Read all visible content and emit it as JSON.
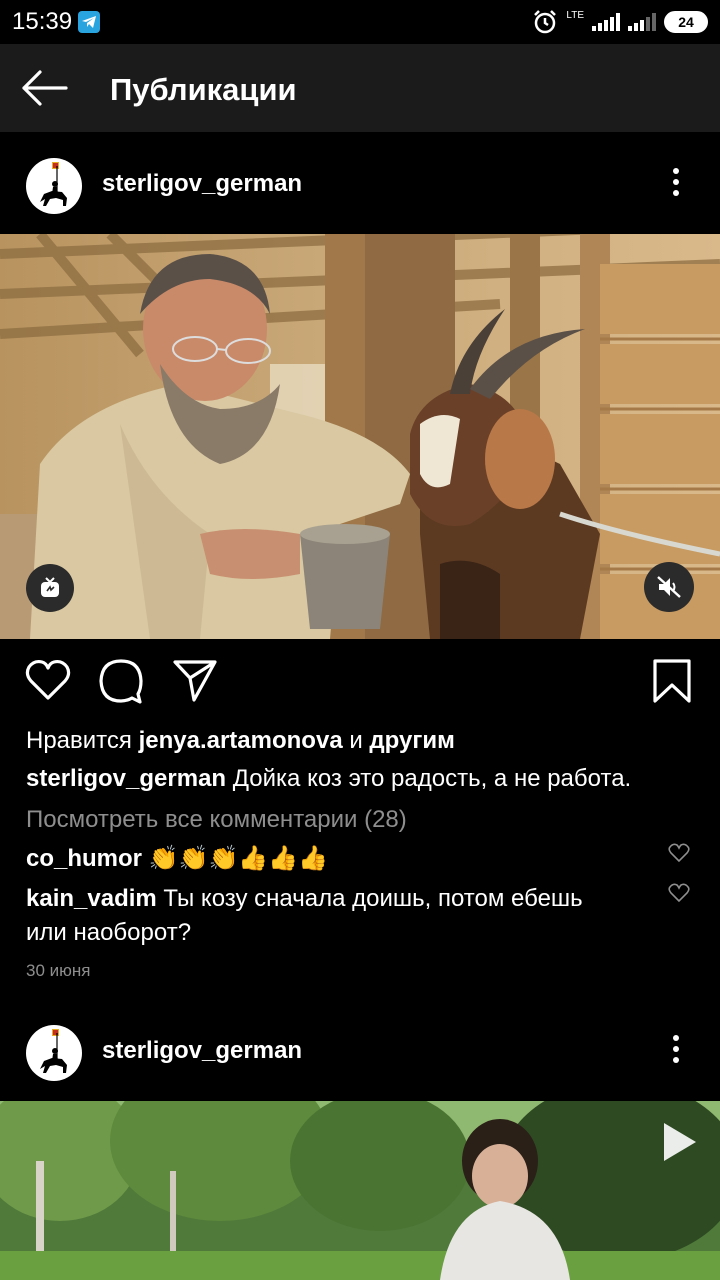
{
  "status_bar": {
    "time": "15:39",
    "network_label": "LTE",
    "battery": "24",
    "icons": [
      "telegram-icon",
      "alarm-icon",
      "signal-icon",
      "battery-icon"
    ]
  },
  "app_bar": {
    "title": "Публикации",
    "back_icon": "back-arrow-icon"
  },
  "posts": [
    {
      "username": "sterligov_german",
      "likes": {
        "prefix": "Нравится ",
        "user": "jenya.artamonova",
        "middle": " и ",
        "others": "другим"
      },
      "caption": {
        "user": "sterligov_german",
        "text": " Дойка коз это радость, а не работа."
      },
      "view_comments": "Посмотреть все комментарии (28)",
      "comments": [
        {
          "user": "co_humor",
          "text": " 👏👏👏👍👍👍"
        },
        {
          "user": "kain_vadim",
          "text": " Ты козу сначала доишь, потом ебешь",
          "text2": "или наоборот?"
        }
      ],
      "date": "30 июня"
    },
    {
      "username": "sterligov_german"
    }
  ],
  "colors": {
    "background": "#000000",
    "app_bar": "#1b1b1b",
    "muted_text": "#8e8e8e",
    "telegram": "#2aa4df"
  }
}
